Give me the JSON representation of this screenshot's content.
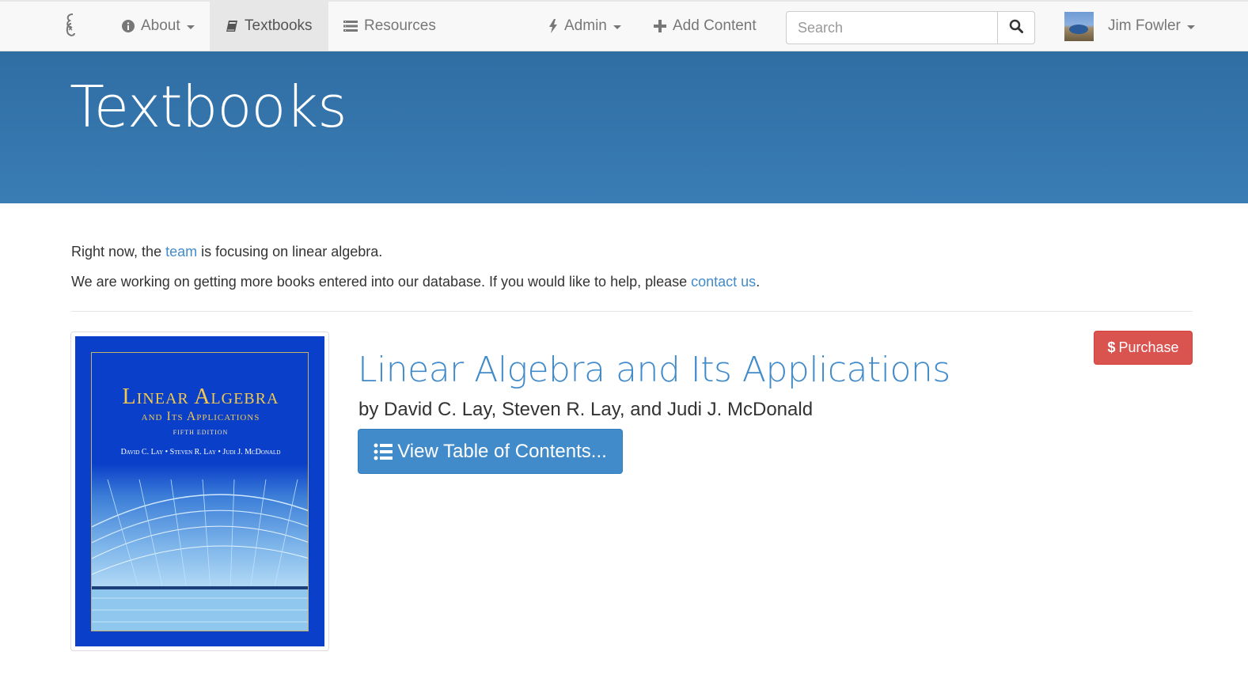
{
  "navbar": {
    "brand_icon": "ximera-logo-icon",
    "items": [
      {
        "label": "About",
        "icon": "info-icon",
        "dropdown": true
      },
      {
        "label": "Textbooks",
        "icon": "book-icon",
        "active": true
      },
      {
        "label": "Resources",
        "icon": "list-icon"
      },
      {
        "label": "Admin",
        "icon": "bolt-icon",
        "dropdown": true
      },
      {
        "label": "Add Content",
        "icon": "plus-icon"
      }
    ],
    "search": {
      "placeholder": "Search",
      "value": ""
    },
    "user": {
      "name": "Jim Fowler",
      "avatar": "avatar"
    }
  },
  "header": {
    "title": "Textbooks"
  },
  "intro": {
    "line1_before": "Right now, the ",
    "line1_link": "team",
    "line1_after": " is focusing on linear algebra.",
    "line2_before": "We are working on getting more books entered into our database. If you would like to help, please ",
    "line2_link": "contact us",
    "line2_after": "."
  },
  "book": {
    "title": "Linear Algebra and Its Applications",
    "authors": "by David C. Lay, Steven R. Lay, and Judi J. McDonald",
    "toc_label": "View Table of Contents...",
    "purchase_label": "Purchase",
    "cover": {
      "title": "Linear Algebra",
      "subtitle": "and Its Applications",
      "edition": "Fifth Edition",
      "authors": "David C. Lay • Steven R. Lay • Judi J. McDonald"
    }
  },
  "colors": {
    "accent": "#428bca",
    "header_bg": "#3379b3",
    "purchase": "#d9534f"
  }
}
